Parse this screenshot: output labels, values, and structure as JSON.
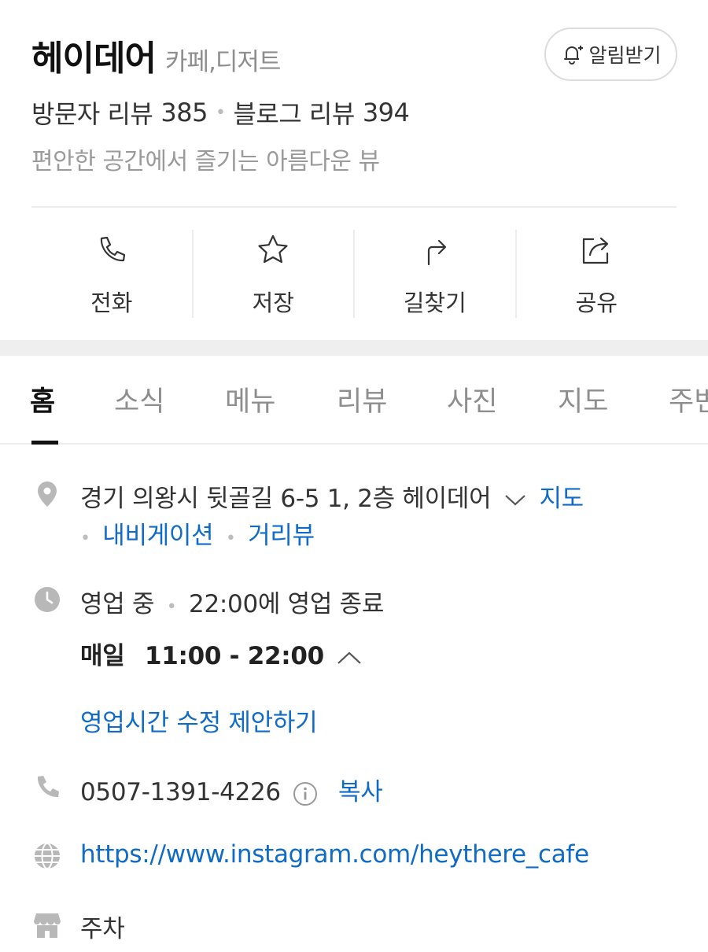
{
  "header": {
    "name": "헤이데어",
    "category": "카페,디저트",
    "alert_label": "알림받기",
    "visitor_review_label": "방문자 리뷰",
    "visitor_review_count": "385",
    "blog_review_label": "블로그 리뷰",
    "blog_review_count": "394",
    "description": "편안한 공간에서 즐기는 아름다운 뷰"
  },
  "actions": [
    {
      "label": "전화",
      "icon": "phone-icon"
    },
    {
      "label": "저장",
      "icon": "star-icon"
    },
    {
      "label": "길찾기",
      "icon": "directions-icon"
    },
    {
      "label": "공유",
      "icon": "share-icon"
    }
  ],
  "tabs": [
    "홈",
    "소식",
    "메뉴",
    "리뷰",
    "사진",
    "지도",
    "주변"
  ],
  "active_tab": "홈",
  "info": {
    "address": "경기 의왕시 뒷골길 6-5 1, 2층 헤이데어",
    "map_link": "지도",
    "navigation_link": "내비게이션",
    "street_view_link": "거리뷰",
    "open_status": "영업 중",
    "close_notice": "22:00에 영업 종료",
    "hours_day": "매일",
    "hours_time": "11:00 - 22:00",
    "suggest_edit": "영업시간 수정 제안하기",
    "phone": "0507-1391-4226",
    "copy_label": "복사",
    "website": "https://www.instagram.com/heythere_cafe",
    "parking": "주차"
  },
  "colors": {
    "link": "#0f6bc7",
    "icon_gray": "#b8b8b8",
    "text": "#333333",
    "muted": "#9a9a9a"
  }
}
